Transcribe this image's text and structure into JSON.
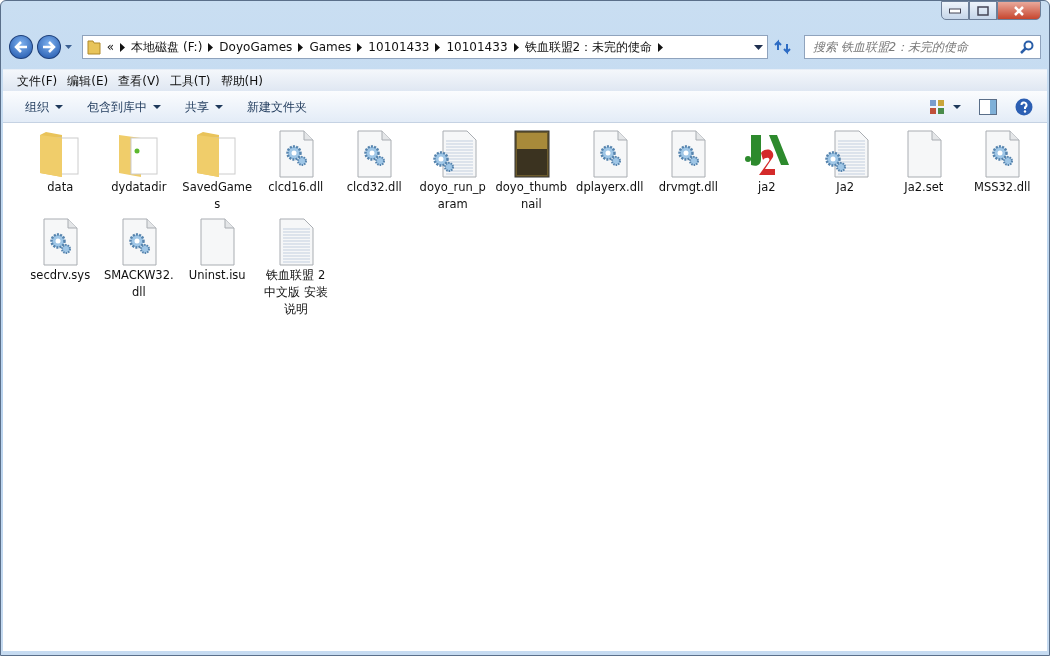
{
  "address_bar": {
    "overflow": "«",
    "segments": [
      "本地磁盘 (F:)",
      "DoyoGames",
      "Games",
      "10101433",
      "10101433",
      "铁血联盟2：未完的使命"
    ]
  },
  "search": {
    "placeholder": "搜索 铁血联盟2：未完的使命"
  },
  "menu": [
    "文件(F)",
    "编辑(E)",
    "查看(V)",
    "工具(T)",
    "帮助(H)"
  ],
  "commands": [
    {
      "label": "组织",
      "dropdown": true
    },
    {
      "label": "包含到库中",
      "dropdown": true
    },
    {
      "label": "共享",
      "dropdown": true
    },
    {
      "label": "新建文件夹",
      "dropdown": false
    }
  ],
  "files": [
    {
      "name": "data",
      "kind": "folder"
    },
    {
      "name": "dydatadir",
      "kind": "folder-green"
    },
    {
      "name": "SavedGames",
      "kind": "folder"
    },
    {
      "name": "clcd16.dll",
      "kind": "dll"
    },
    {
      "name": "clcd32.dll",
      "kind": "dll"
    },
    {
      "name": "doyo_run_param",
      "kind": "config"
    },
    {
      "name": "doyo_thumbnail",
      "kind": "image"
    },
    {
      "name": "dplayerx.dll",
      "kind": "dll"
    },
    {
      "name": "drvmgt.dll",
      "kind": "dll"
    },
    {
      "name": "ja2",
      "kind": "app"
    },
    {
      "name": "Ja2",
      "kind": "config"
    },
    {
      "name": "Ja2.set",
      "kind": "blank"
    },
    {
      "name": "MSS32.dll",
      "kind": "dll"
    },
    {
      "name": "secdrv.sys",
      "kind": "dll"
    },
    {
      "name": "SMACKW32.dll",
      "kind": "dll"
    },
    {
      "name": "Uninst.isu",
      "kind": "blank"
    },
    {
      "name": "铁血联盟 2 中文版 安装说明",
      "kind": "text"
    }
  ]
}
